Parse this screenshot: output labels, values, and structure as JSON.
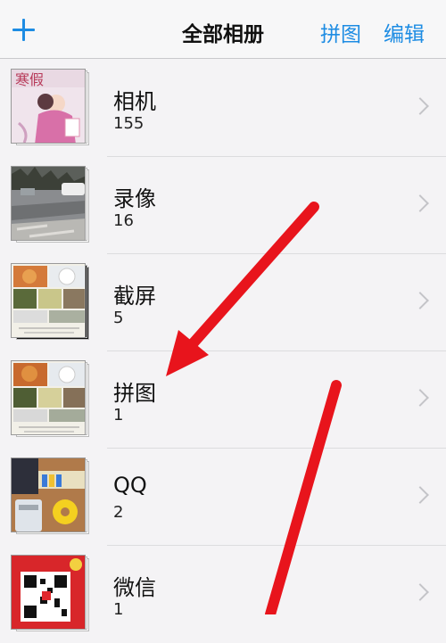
{
  "navbar": {
    "add_icon": "plus-icon",
    "title": "全部相册",
    "puzzle_label": "拼图",
    "edit_label": "编辑",
    "accent_color": "#1d8ce3"
  },
  "albums": [
    {
      "name": "相机",
      "count": "155",
      "thumb_text": "寒假"
    },
    {
      "name": "录像",
      "count": "16"
    },
    {
      "name": "截屏",
      "count": "5"
    },
    {
      "name": "拼图",
      "count": "1"
    },
    {
      "name": "QQ",
      "count": "2"
    },
    {
      "name": "微信",
      "count": "1"
    }
  ],
  "annotation_color": "#e8141c",
  "chevron_icon": "chevron-right-icon"
}
